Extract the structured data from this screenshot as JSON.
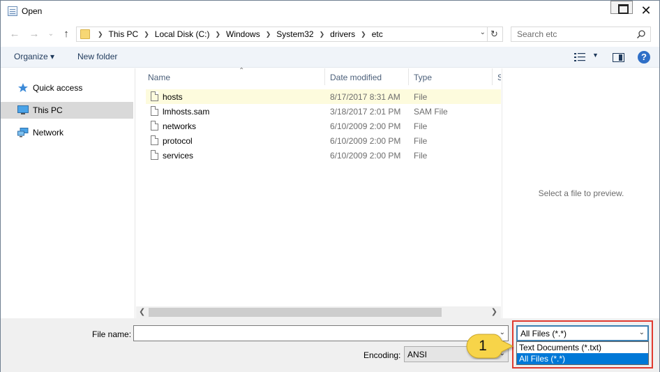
{
  "window": {
    "title": "Open"
  },
  "address": {
    "crumbs": [
      "This PC",
      "Local Disk (C:)",
      "Windows",
      "System32",
      "drivers",
      "etc"
    ]
  },
  "search": {
    "placeholder": "Search etc"
  },
  "toolbar": {
    "organize_label": "Organize ▾",
    "new_folder_label": "New folder"
  },
  "navpane": {
    "items": [
      {
        "label": "Quick access",
        "icon": "star-icon"
      },
      {
        "label": "This PC",
        "icon": "computer-icon"
      },
      {
        "label": "Network",
        "icon": "network-icon"
      }
    ]
  },
  "columns": {
    "name": "Name",
    "date": "Date modified",
    "type": "Type",
    "size": "S"
  },
  "files": [
    {
      "name": "hosts",
      "date": "8/17/2017 8:31 AM",
      "type": "File"
    },
    {
      "name": "lmhosts.sam",
      "date": "3/18/2017 2:01 PM",
      "type": "SAM File"
    },
    {
      "name": "networks",
      "date": "6/10/2009 2:00 PM",
      "type": "File"
    },
    {
      "name": "protocol",
      "date": "6/10/2009 2:00 PM",
      "type": "File"
    },
    {
      "name": "services",
      "date": "6/10/2009 2:00 PM",
      "type": "File"
    }
  ],
  "preview": {
    "text": "Select a file to preview."
  },
  "bottom": {
    "file_name_label": "File name:",
    "file_name_value": "",
    "encoding_label": "Encoding:",
    "encoding_value": "ANSI",
    "filetype_value": "All Files  (*.*)",
    "filetype_options": [
      "Text Documents (*.txt)",
      "All Files  (*.*)"
    ]
  },
  "callout": {
    "number": "1"
  },
  "colors": {
    "highlight": "#e03a2f",
    "selection": "#0078d7",
    "callout": "#f7d44a"
  }
}
